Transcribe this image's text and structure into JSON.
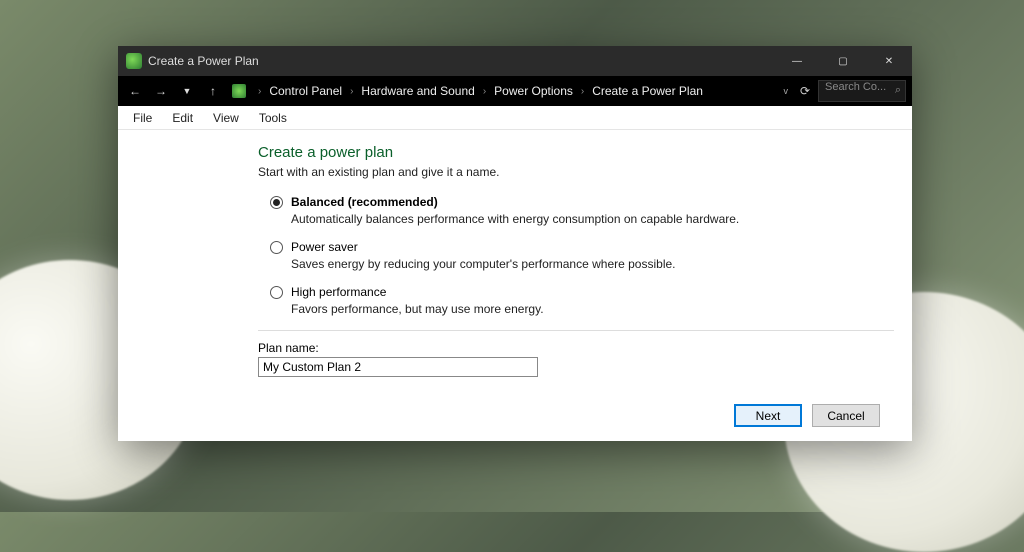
{
  "window": {
    "title": "Create a Power Plan"
  },
  "breadcrumb": {
    "items": [
      "Control Panel",
      "Hardware and Sound",
      "Power Options",
      "Create a Power Plan"
    ]
  },
  "search": {
    "placeholder": "Search Co..."
  },
  "menubar": {
    "items": [
      "File",
      "Edit",
      "View",
      "Tools"
    ]
  },
  "page": {
    "heading": "Create a power plan",
    "subtitle": "Start with an existing plan and give it a name."
  },
  "options": [
    {
      "label": "Balanced (recommended)",
      "description": "Automatically balances performance with energy consumption on capable hardware.",
      "checked": true
    },
    {
      "label": "Power saver",
      "description": "Saves energy by reducing your computer's performance where possible.",
      "checked": false
    },
    {
      "label": "High performance",
      "description": "Favors performance, but may use more energy.",
      "checked": false
    }
  ],
  "plan_name": {
    "label": "Plan name:",
    "value": "My Custom Plan 2"
  },
  "buttons": {
    "next": "Next",
    "cancel": "Cancel"
  }
}
